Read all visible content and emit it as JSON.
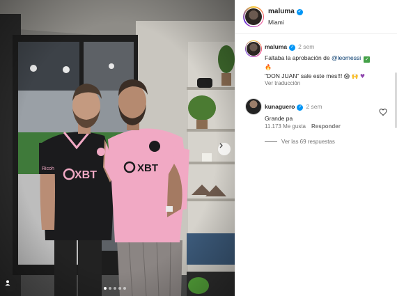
{
  "post": {
    "author": {
      "username": "maluma",
      "verified": true,
      "location": "Miami"
    },
    "carousel": {
      "total_slides": 5,
      "active_slide": 1,
      "jersey_text_left": "XBT",
      "jersey_text_right": "XBT",
      "sleeve_text": "Ricoh"
    },
    "comments": [
      {
        "username": "maluma",
        "verified": true,
        "time": "2 sem",
        "text_before_mention": "Faltaba la aprobación de ",
        "mention": "@leomessi",
        "line2": "\"DON JUAN\" sale este mes!!!",
        "see_translation": "Ver traducción"
      },
      {
        "username": "kunaguero",
        "verified": true,
        "time": "2 sem",
        "text": "Grande pa",
        "likes": "11.173 Me gusta",
        "reply_label": "Responder",
        "view_replies": "Ver las 69 respuestas"
      }
    ]
  },
  "icons": {
    "verified": "verified-badge-icon",
    "next": "chevron-right-icon",
    "tag": "user-tag-icon",
    "like": "heart-icon"
  },
  "colors": {
    "verified_blue": "#0095f6",
    "pink_jersey": "#f1a9c4",
    "dark_jersey": "#1b1b1d",
    "link": "#00376b"
  }
}
